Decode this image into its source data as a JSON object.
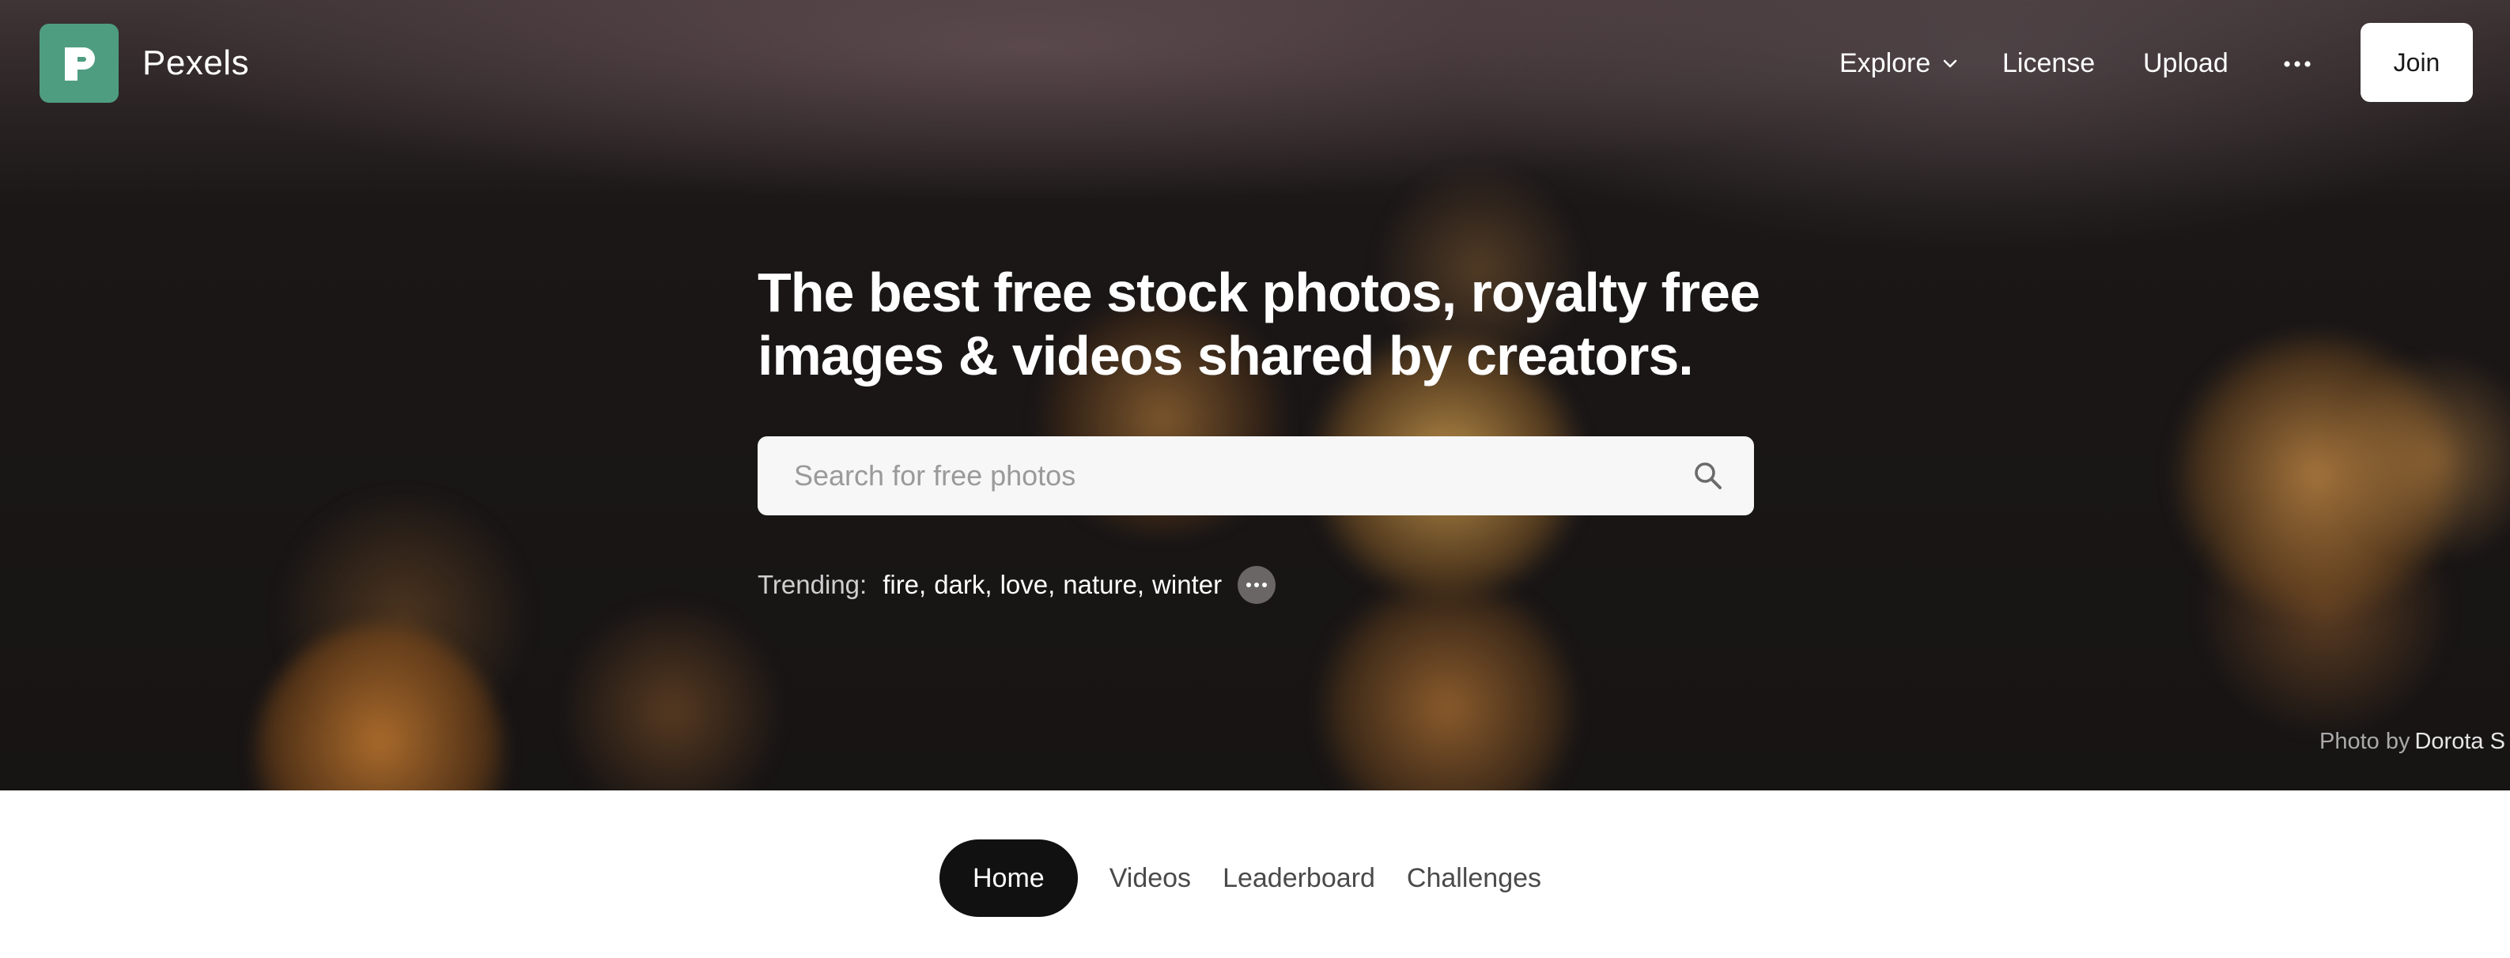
{
  "header": {
    "brand": "Pexels",
    "nav": {
      "explore": "Explore",
      "license": "License",
      "upload": "Upload",
      "join": "Join"
    }
  },
  "hero": {
    "headline_line1": "The best free stock photos, royalty free",
    "headline_line2": "images & videos shared by creators.",
    "search": {
      "placeholder": "Search for free photos"
    },
    "trending": {
      "label": "Trending:",
      "tags": [
        "fire",
        "dark",
        "love",
        "nature",
        "winter"
      ]
    },
    "credit": {
      "prefix": "Photo by",
      "author": "Dorota S"
    }
  },
  "tabs": [
    "Home",
    "Videos",
    "Leaderboard",
    "Challenges"
  ],
  "colors": {
    "brand": "#4f9d81",
    "active_tab": "#111111",
    "search_bg": "#f7f7f7"
  },
  "icons": [
    "pexels-logo-icon",
    "chevron-down-icon",
    "more-horizontal-icon",
    "search-icon",
    "more-dots-icon"
  ]
}
